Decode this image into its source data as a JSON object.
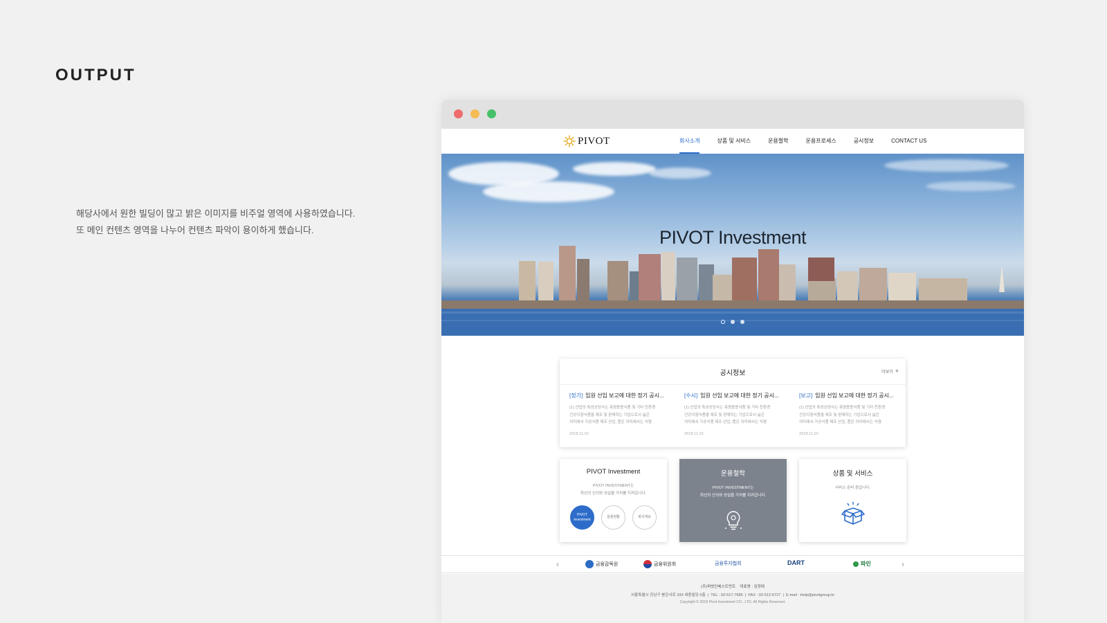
{
  "heading": "OUTPUT",
  "description": {
    "line1": "해당사에서 원한 빌딩이 많고 밝은 이미지를 비주얼 영역에 사용하였습니다.",
    "line2": "또 메인 컨텐츠 영역을 나누어 컨텐츠 파악이 용이하게 했습니다."
  },
  "site": {
    "logo": "PIVOT",
    "nav": [
      "회사소개",
      "상품 및 서비스",
      "운용철학",
      "운용프로세스",
      "공시정보",
      "CONTACT US"
    ],
    "active_nav": "회사소개",
    "hero_title": "PIVOT Investment",
    "slider_count": 3,
    "notice": {
      "title": "공시정보",
      "more": "더보기",
      "items": [
        {
          "tag": "[정기]",
          "title": "임원 선임 보고에 대한 정기 공시...",
          "body1": "(1) 산업의 특성상당사는 축염용용식품 및 기타 친환경",
          "body2": "건강지향식품을 제조 및 판매하는 기업으로서 넓은",
          "body3": "의미에서 가공식품 제조 산업, 좁은 의미에서는 식염",
          "date": "2018.11.10"
        },
        {
          "tag": "[수시]",
          "title": "임원 선임 보고에 대한 정기 공시...",
          "body1": "(1) 산업의 특성상당사는 축염용용식품 및 기타 친환경",
          "body2": "건강지향식품을 제조 및 판매하는 기업으로서 넓은",
          "body3": "의미에서 가공식품 제조 산업, 좁은 의미에서는 식염",
          "date": "2018.11.10"
        },
        {
          "tag": "[보고]",
          "title": "임원 선임 보고에 대한 정기 공시...",
          "body1": "(1) 산업의 특성상당사는 축염용용식품 및 기타 친환경",
          "body2": "건강지향식품을 제조 및 판매하는 기업으로서 넓은",
          "body3": "의미에서 가공식품 제조 산업, 좁은 의미에서는 식염",
          "date": "2018.11.10"
        }
      ]
    },
    "cards": {
      "invest": {
        "title": "PIVOT Investment",
        "sub1": "PIVOT INVESTMENT는",
        "sub2": "최선의 신의와 성실을 가치를 지켜갑니다.",
        "circle1_line1": "PIVOT",
        "circle1_line2": "investment",
        "circle2": "운용현황",
        "circle3": "회사개요"
      },
      "philosophy": {
        "title": "운용철학",
        "sub1": "PIVOT INVESTMENT는",
        "sub2": "최선의 신의와 성실을 가치를 지켜갑니다."
      },
      "products": {
        "title": "상품 및 서비스",
        "sub1": "서비스 준비 중입니다."
      }
    },
    "partners": [
      "금융감독원",
      "금융위원회",
      "금융투자협회",
      "DART",
      "파인"
    ],
    "footer": {
      "company": "(주)피벗인베스트먼트",
      "ceo": "대표명 : 김정태",
      "address": "서울특별시 강남구 봉은사로 333 세종빌딩 5층",
      "tel": "TEL : 02-517-7685",
      "fax": "FAX : 02-512-5727",
      "email": "E-mail : Help@pivotgroup.kr",
      "copyright": "Copyright © 2018 Pivot Investment CO., LTD.  All Rights Reserved."
    }
  },
  "colors": {
    "accent": "#2d6cc9",
    "window_red": "#f06b6b",
    "window_yellow": "#f5bb54",
    "window_green": "#46c16a",
    "card_gray": "#7c838d"
  }
}
